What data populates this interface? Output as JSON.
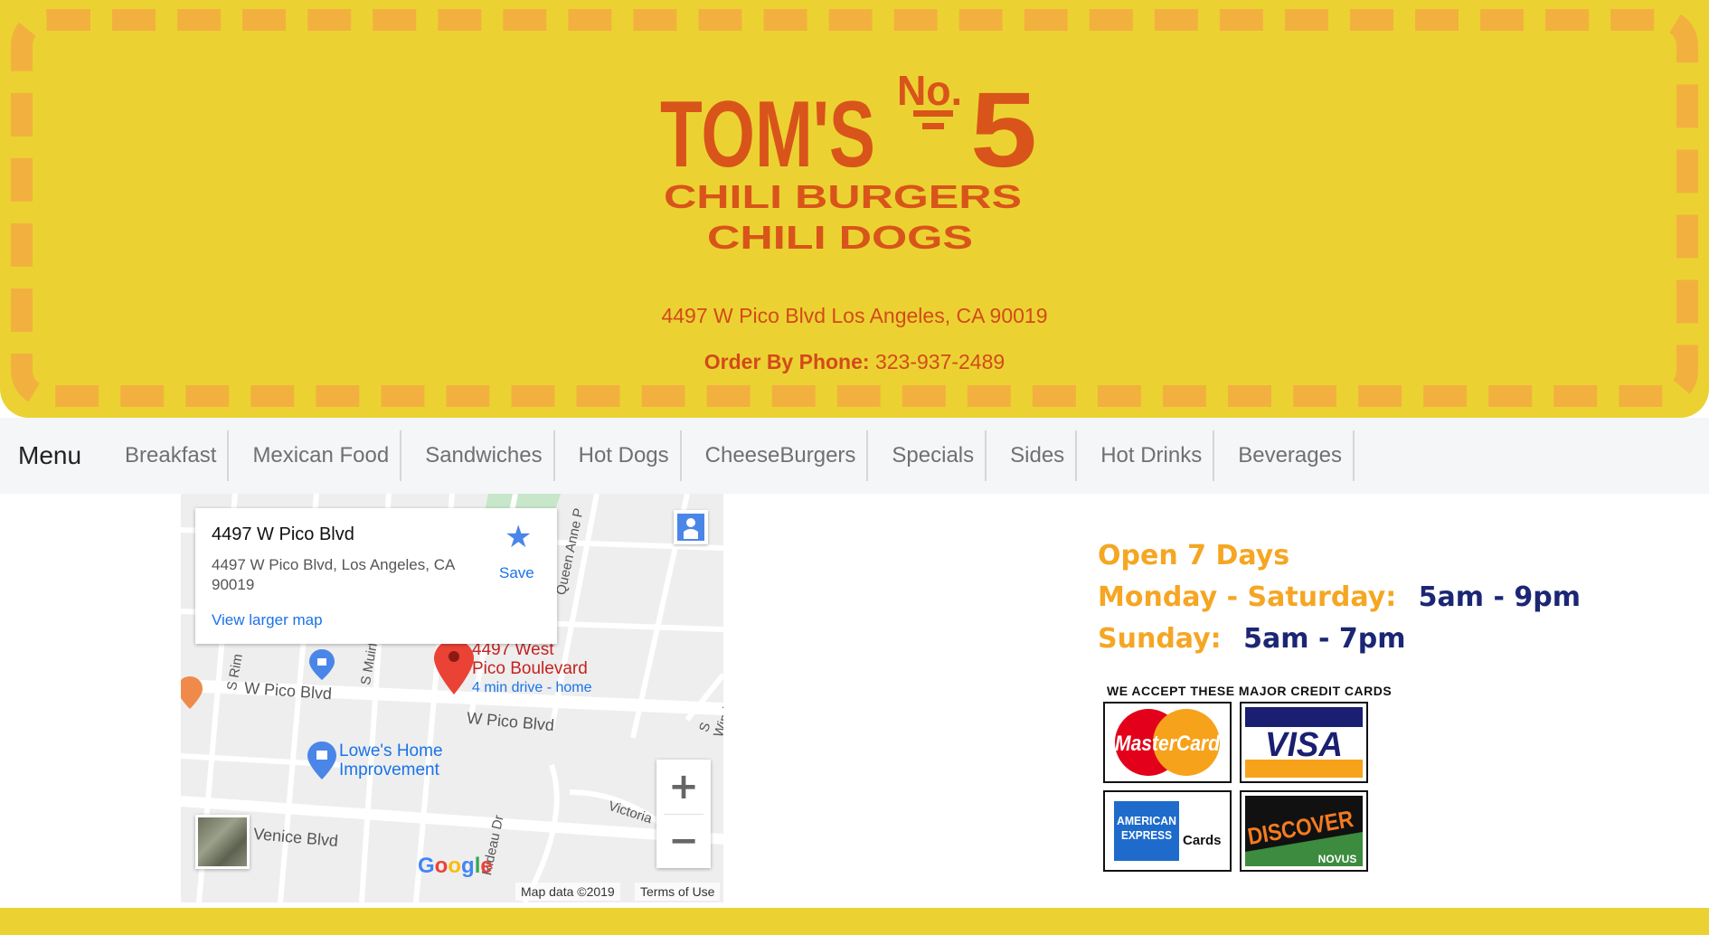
{
  "header": {
    "logo": {
      "name": "TOM'S",
      "no_label": "No.",
      "number": "5",
      "line1": "CHILI BURGERS",
      "line2": "CHILI DOGS"
    },
    "address": "4497 W Pico Blvd Los Angeles, CA 90019",
    "phone_label": "Order By Phone:",
    "phone_number": "323-937-2489"
  },
  "nav": {
    "brand": "Menu",
    "items": [
      "Breakfast",
      "Mexican Food",
      "Sandwiches",
      "Hot Dogs",
      "CheeseBurgers",
      "Specials",
      "Sides",
      "Hot Drinks",
      "Beverages"
    ]
  },
  "map": {
    "card_title": "4497 W Pico Blvd",
    "card_address": "4497 W Pico Blvd, Los Angeles, CA 90019",
    "view_larger": "View larger map",
    "save_label": "Save",
    "pin_line1": "4497 West",
    "pin_line2": "Pico Boulevard",
    "pin_drive": "4 min drive - home",
    "poi_line1": "Lowe's Home",
    "poi_line2": "Improvement",
    "streets": {
      "pico_left": "W Pico Blvd",
      "pico_right": "W Pico Blvd",
      "venice": "Venice Blvd",
      "victoria": "Victoria",
      "s_muirfield": "S Muirfi",
      "s_rim": "S Rim",
      "queen_anne": "Queen Anne P",
      "s_windsor": "S Winds",
      "rideau": "Rideau Dr"
    },
    "google_logo": "Google",
    "map_data": "Map data ©2019",
    "terms": "Terms of Use",
    "zoom_in": "+",
    "zoom_out": "−"
  },
  "hours": {
    "open": "Open 7 Days",
    "weekday_label": "Monday - Saturday:",
    "weekday_hours": "5am - 9pm",
    "sunday_label": "Sunday:",
    "sunday_hours": "5am - 7pm"
  },
  "credit_cards": {
    "title": "WE ACCEPT THESE MAJOR CREDIT CARDS",
    "mastercard": "MasterCard",
    "visa": "VISA",
    "amex_line1": "AMERICAN",
    "amex_line2": "EXPRESS",
    "amex_cards": "Cards",
    "discover": "DISCOVER",
    "novus": "NOVUS"
  },
  "colors": {
    "header_bg": "#EBD232",
    "dash": "#F2B13E",
    "logo": "#D9541A",
    "orange_text": "#F5A623",
    "navy_text": "#1B2674"
  }
}
